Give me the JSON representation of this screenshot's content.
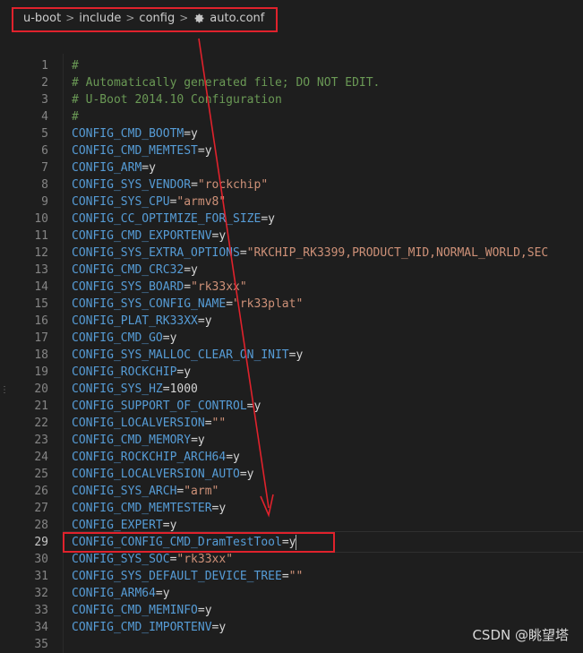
{
  "breadcrumb": {
    "items": [
      "u-boot",
      "include",
      "config",
      "auto.conf"
    ],
    "separator": ">",
    "file_icon": "gear-icon"
  },
  "editor": {
    "active_line": 29,
    "lines": [
      {
        "n": "1",
        "tokens": [
          {
            "c": "cmt",
            "t": "#"
          }
        ]
      },
      {
        "n": "2",
        "tokens": [
          {
            "c": "cmt",
            "t": "# Automatically generated file; DO NOT EDIT."
          }
        ]
      },
      {
        "n": "3",
        "tokens": [
          {
            "c": "cmt",
            "t": "# U-Boot 2014.10 Configuration"
          }
        ]
      },
      {
        "n": "4",
        "tokens": [
          {
            "c": "cmt",
            "t": "#"
          }
        ]
      },
      {
        "n": "5",
        "tokens": [
          {
            "c": "key",
            "t": "CONFIG_CMD_BOOTM"
          },
          {
            "c": "op",
            "t": "=y"
          }
        ]
      },
      {
        "n": "6",
        "tokens": [
          {
            "c": "key",
            "t": "CONFIG_CMD_MEMTEST"
          },
          {
            "c": "op",
            "t": "=y"
          }
        ]
      },
      {
        "n": "7",
        "tokens": [
          {
            "c": "key",
            "t": "CONFIG_ARM"
          },
          {
            "c": "op",
            "t": "=y"
          }
        ]
      },
      {
        "n": "8",
        "tokens": [
          {
            "c": "key",
            "t": "CONFIG_SYS_VENDOR"
          },
          {
            "c": "op",
            "t": "="
          },
          {
            "c": "str",
            "t": "\"rockchip\""
          }
        ]
      },
      {
        "n": "9",
        "tokens": [
          {
            "c": "key",
            "t": "CONFIG_SYS_CPU"
          },
          {
            "c": "op",
            "t": "="
          },
          {
            "c": "str",
            "t": "\"armv8\""
          }
        ]
      },
      {
        "n": "10",
        "tokens": [
          {
            "c": "key",
            "t": "CONFIG_CC_OPTIMIZE_FOR_SIZE"
          },
          {
            "c": "op",
            "t": "=y"
          }
        ]
      },
      {
        "n": "11",
        "tokens": [
          {
            "c": "key",
            "t": "CONFIG_CMD_EXPORTENV"
          },
          {
            "c": "op",
            "t": "=y"
          }
        ]
      },
      {
        "n": "12",
        "tokens": [
          {
            "c": "key",
            "t": "CONFIG_SYS_EXTRA_OPTIONS"
          },
          {
            "c": "op",
            "t": "="
          },
          {
            "c": "str",
            "t": "\"RKCHIP_RK3399,PRODUCT_MID,NORMAL_WORLD,SEC"
          }
        ]
      },
      {
        "n": "13",
        "tokens": [
          {
            "c": "key",
            "t": "CONFIG_CMD_CRC32"
          },
          {
            "c": "op",
            "t": "=y"
          }
        ]
      },
      {
        "n": "14",
        "tokens": [
          {
            "c": "key",
            "t": "CONFIG_SYS_BOARD"
          },
          {
            "c": "op",
            "t": "="
          },
          {
            "c": "str",
            "t": "\"rk33xx\""
          }
        ]
      },
      {
        "n": "15",
        "tokens": [
          {
            "c": "key",
            "t": "CONFIG_SYS_CONFIG_NAME"
          },
          {
            "c": "op",
            "t": "="
          },
          {
            "c": "str",
            "t": "\"rk33plat\""
          }
        ]
      },
      {
        "n": "16",
        "tokens": [
          {
            "c": "key",
            "t": "CONFIG_PLAT_RK33XX"
          },
          {
            "c": "op",
            "t": "=y"
          }
        ]
      },
      {
        "n": "17",
        "tokens": [
          {
            "c": "key",
            "t": "CONFIG_CMD_GO"
          },
          {
            "c": "op",
            "t": "=y"
          }
        ]
      },
      {
        "n": "18",
        "tokens": [
          {
            "c": "key",
            "t": "CONFIG_SYS_MALLOC_CLEAR_ON_INIT"
          },
          {
            "c": "op",
            "t": "=y"
          }
        ]
      },
      {
        "n": "19",
        "tokens": [
          {
            "c": "key",
            "t": "CONFIG_ROCKCHIP"
          },
          {
            "c": "op",
            "t": "=y"
          }
        ]
      },
      {
        "n": "20",
        "tokens": [
          {
            "c": "key",
            "t": "CONFIG_SYS_HZ"
          },
          {
            "c": "op",
            "t": "="
          },
          {
            "c": "op",
            "t": "1000"
          }
        ]
      },
      {
        "n": "21",
        "tokens": [
          {
            "c": "key",
            "t": "CONFIG_SUPPORT_OF_CONTROL"
          },
          {
            "c": "op",
            "t": "=y"
          }
        ]
      },
      {
        "n": "22",
        "tokens": [
          {
            "c": "key",
            "t": "CONFIG_LOCALVERSION"
          },
          {
            "c": "op",
            "t": "="
          },
          {
            "c": "str",
            "t": "\"\""
          }
        ]
      },
      {
        "n": "23",
        "tokens": [
          {
            "c": "key",
            "t": "CONFIG_CMD_MEMORY"
          },
          {
            "c": "op",
            "t": "=y"
          }
        ]
      },
      {
        "n": "24",
        "tokens": [
          {
            "c": "key",
            "t": "CONFIG_ROCKCHIP_ARCH64"
          },
          {
            "c": "op",
            "t": "=y"
          }
        ]
      },
      {
        "n": "25",
        "tokens": [
          {
            "c": "key",
            "t": "CONFIG_LOCALVERSION_AUTO"
          },
          {
            "c": "op",
            "t": "=y"
          }
        ]
      },
      {
        "n": "26",
        "tokens": [
          {
            "c": "key",
            "t": "CONFIG_SYS_ARCH"
          },
          {
            "c": "op",
            "t": "="
          },
          {
            "c": "str",
            "t": "\"arm\""
          }
        ]
      },
      {
        "n": "27",
        "tokens": [
          {
            "c": "key",
            "t": "CONFIG_CMD_MEMTESTER"
          },
          {
            "c": "op",
            "t": "=y"
          }
        ]
      },
      {
        "n": "28",
        "tokens": [
          {
            "c": "key",
            "t": "CONFIG_EXPERT"
          },
          {
            "c": "op",
            "t": "=y"
          }
        ]
      },
      {
        "n": "29",
        "tokens": [
          {
            "c": "key",
            "t": "CONFIG_CONFIG_CMD_DramTestTool"
          },
          {
            "c": "op",
            "t": "=y"
          }
        ]
      },
      {
        "n": "30",
        "tokens": [
          {
            "c": "key",
            "t": "CONFIG_SYS_SOC"
          },
          {
            "c": "op",
            "t": "="
          },
          {
            "c": "str",
            "t": "\"rk33xx\""
          }
        ]
      },
      {
        "n": "31",
        "tokens": [
          {
            "c": "key",
            "t": "CONFIG_SYS_DEFAULT_DEVICE_TREE"
          },
          {
            "c": "op",
            "t": "="
          },
          {
            "c": "str",
            "t": "\"\""
          }
        ]
      },
      {
        "n": "32",
        "tokens": [
          {
            "c": "key",
            "t": "CONFIG_ARM64"
          },
          {
            "c": "op",
            "t": "=y"
          }
        ]
      },
      {
        "n": "33",
        "tokens": [
          {
            "c": "key",
            "t": "CONFIG_CMD_MEMINFO"
          },
          {
            "c": "op",
            "t": "=y"
          }
        ]
      },
      {
        "n": "34",
        "tokens": [
          {
            "c": "key",
            "t": "CONFIG_CMD_IMPORTENV"
          },
          {
            "c": "op",
            "t": "=y"
          }
        ]
      },
      {
        "n": "35",
        "tokens": []
      }
    ]
  },
  "watermark": "CSDN @眺望塔",
  "colors": {
    "background": "#1e1e1e",
    "annotation_red": "#e0222c",
    "comment": "#6a9955",
    "keyword": "#569cd6",
    "string": "#ce9178"
  }
}
